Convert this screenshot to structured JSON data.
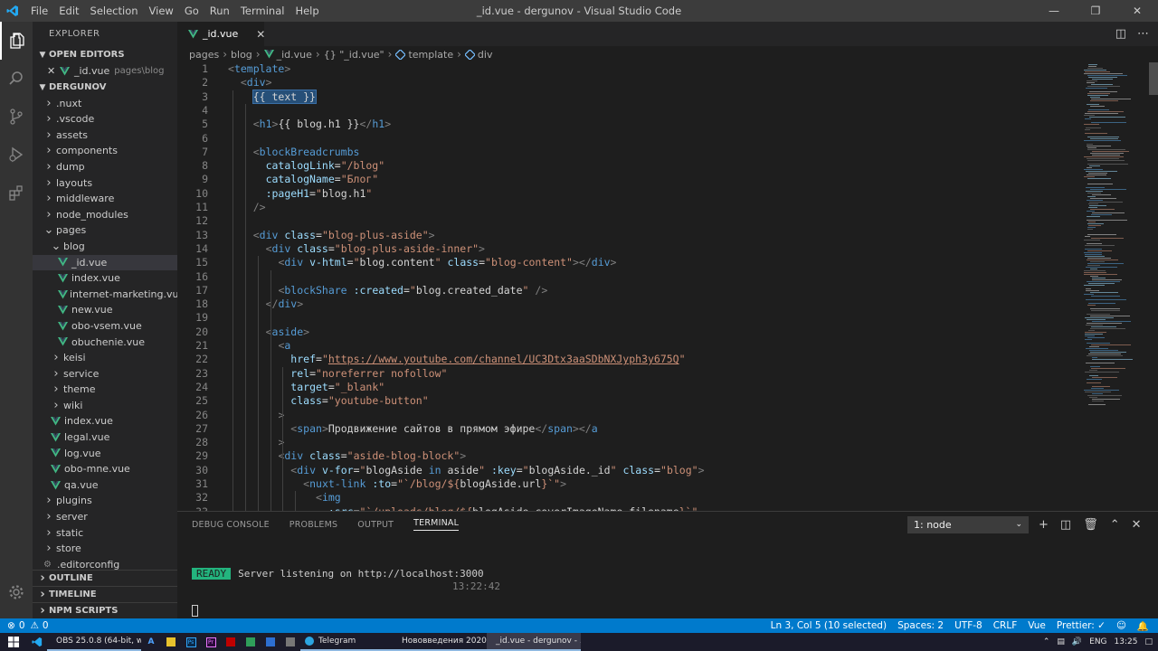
{
  "window": {
    "title": "_id.vue - dergunov - Visual Studio Code",
    "menu": [
      "File",
      "Edit",
      "Selection",
      "View",
      "Go",
      "Run",
      "Terminal",
      "Help"
    ]
  },
  "sidebar": {
    "title": "EXPLORER",
    "open_editors_label": "OPEN EDITORS",
    "open_editor": {
      "name": "_id.vue",
      "path": "pages\\blog"
    },
    "project_label": "DERGUNOV",
    "tree": [
      {
        "label": ".nuxt",
        "kind": "folder",
        "depth": 1
      },
      {
        "label": ".vscode",
        "kind": "folder",
        "depth": 1
      },
      {
        "label": "assets",
        "kind": "folder",
        "depth": 1
      },
      {
        "label": "components",
        "kind": "folder",
        "depth": 1
      },
      {
        "label": "dump",
        "kind": "folder",
        "depth": 1
      },
      {
        "label": "layouts",
        "kind": "folder",
        "depth": 1
      },
      {
        "label": "middleware",
        "kind": "folder",
        "depth": 1
      },
      {
        "label": "node_modules",
        "kind": "folder",
        "depth": 1
      },
      {
        "label": "pages",
        "kind": "folder-open",
        "depth": 1
      },
      {
        "label": "blog",
        "kind": "folder-open",
        "depth": 2
      },
      {
        "label": "_id.vue",
        "kind": "vue",
        "depth": 3,
        "selected": true
      },
      {
        "label": "index.vue",
        "kind": "vue",
        "depth": 3
      },
      {
        "label": "internet-marketing.vue",
        "kind": "vue",
        "depth": 3
      },
      {
        "label": "new.vue",
        "kind": "vue",
        "depth": 3
      },
      {
        "label": "obo-vsem.vue",
        "kind": "vue",
        "depth": 3
      },
      {
        "label": "obuchenie.vue",
        "kind": "vue",
        "depth": 3
      },
      {
        "label": "keisi",
        "kind": "folder",
        "depth": 2
      },
      {
        "label": "service",
        "kind": "folder",
        "depth": 2
      },
      {
        "label": "theme",
        "kind": "folder",
        "depth": 2
      },
      {
        "label": "wiki",
        "kind": "folder",
        "depth": 2
      },
      {
        "label": "index.vue",
        "kind": "vue",
        "depth": 2
      },
      {
        "label": "legal.vue",
        "kind": "vue",
        "depth": 2
      },
      {
        "label": "log.vue",
        "kind": "vue",
        "depth": 2
      },
      {
        "label": "obo-mne.vue",
        "kind": "vue",
        "depth": 2
      },
      {
        "label": "qa.vue",
        "kind": "vue",
        "depth": 2
      },
      {
        "label": "plugins",
        "kind": "folder",
        "depth": 1
      },
      {
        "label": "server",
        "kind": "folder",
        "depth": 1
      },
      {
        "label": "static",
        "kind": "folder",
        "depth": 1
      },
      {
        "label": "store",
        "kind": "folder",
        "depth": 1
      },
      {
        "label": ".editorconfig",
        "kind": "config",
        "depth": 1
      }
    ],
    "bottom_sections": [
      "OUTLINE",
      "TIMELINE",
      "NPM SCRIPTS"
    ]
  },
  "editor": {
    "tab_label": "_id.vue",
    "breadcrumb": [
      "pages",
      "blog",
      "_id.vue",
      "{} \"_id.vue\"",
      "template",
      "div"
    ],
    "lines": [
      {
        "n": 1,
        "indent": 0,
        "parts": [
          [
            "br",
            "<"
          ],
          [
            "tg",
            "template"
          ],
          [
            "br",
            ">"
          ]
        ]
      },
      {
        "n": 2,
        "indent": 1,
        "parts": [
          [
            "br",
            "<"
          ],
          [
            "tg",
            "div"
          ],
          [
            "br",
            ">"
          ]
        ]
      },
      {
        "n": 3,
        "indent": 2,
        "parts": [
          [
            "sel",
            "{{ text }}"
          ]
        ]
      },
      {
        "n": 4,
        "indent": 0,
        "parts": []
      },
      {
        "n": 5,
        "indent": 2,
        "parts": [
          [
            "br",
            "<"
          ],
          [
            "tg",
            "h1"
          ],
          [
            "br",
            ">"
          ],
          [
            "tx",
            "{{ blog.h1 }}"
          ],
          [
            "br",
            "</"
          ],
          [
            "tg",
            "h1"
          ],
          [
            "br",
            ">"
          ]
        ]
      },
      {
        "n": 6,
        "indent": 0,
        "parts": []
      },
      {
        "n": 7,
        "indent": 2,
        "parts": [
          [
            "br",
            "<"
          ],
          [
            "tg",
            "blockBreadcrumbs"
          ]
        ]
      },
      {
        "n": 8,
        "indent": 3,
        "parts": [
          [
            "at",
            "catalogLink"
          ],
          [
            "tx",
            "="
          ],
          [
            "st",
            "\"/blog\""
          ]
        ]
      },
      {
        "n": 9,
        "indent": 3,
        "parts": [
          [
            "at",
            "catalogName"
          ],
          [
            "tx",
            "="
          ],
          [
            "st",
            "\"Блог\""
          ]
        ]
      },
      {
        "n": 10,
        "indent": 3,
        "parts": [
          [
            "at",
            ":pageH1"
          ],
          [
            "tx",
            "="
          ],
          [
            "st",
            "\""
          ],
          [
            "tx",
            "blog.h1"
          ],
          [
            "st",
            "\""
          ]
        ]
      },
      {
        "n": 11,
        "indent": 2,
        "parts": [
          [
            "br",
            "/>"
          ]
        ]
      },
      {
        "n": 12,
        "indent": 0,
        "parts": []
      },
      {
        "n": 13,
        "indent": 2,
        "parts": [
          [
            "br",
            "<"
          ],
          [
            "tg",
            "div"
          ],
          [
            "tx",
            " "
          ],
          [
            "at",
            "class"
          ],
          [
            "tx",
            "="
          ],
          [
            "st",
            "\"blog-plus-aside\""
          ],
          [
            "br",
            ">"
          ]
        ]
      },
      {
        "n": 14,
        "indent": 3,
        "parts": [
          [
            "br",
            "<"
          ],
          [
            "tg",
            "div"
          ],
          [
            "tx",
            " "
          ],
          [
            "at",
            "class"
          ],
          [
            "tx",
            "="
          ],
          [
            "st",
            "\"blog-plus-aside-inner\""
          ],
          [
            "br",
            ">"
          ]
        ]
      },
      {
        "n": 15,
        "indent": 4,
        "parts": [
          [
            "br",
            "<"
          ],
          [
            "tg",
            "div"
          ],
          [
            "tx",
            " "
          ],
          [
            "at",
            "v-html"
          ],
          [
            "tx",
            "="
          ],
          [
            "st",
            "\""
          ],
          [
            "tx",
            "blog.content"
          ],
          [
            "st",
            "\""
          ],
          [
            "tx",
            " "
          ],
          [
            "at",
            "class"
          ],
          [
            "tx",
            "="
          ],
          [
            "st",
            "\"blog-content\""
          ],
          [
            "br",
            "></"
          ],
          [
            "tg",
            "div"
          ],
          [
            "br",
            ">"
          ]
        ]
      },
      {
        "n": 16,
        "indent": 0,
        "parts": []
      },
      {
        "n": 17,
        "indent": 4,
        "parts": [
          [
            "br",
            "<"
          ],
          [
            "tg",
            "blockShare"
          ],
          [
            "tx",
            " "
          ],
          [
            "at",
            ":created"
          ],
          [
            "tx",
            "="
          ],
          [
            "st",
            "\""
          ],
          [
            "tx",
            "blog.created_date"
          ],
          [
            "st",
            "\""
          ],
          [
            "tx",
            " "
          ],
          [
            "br",
            "/>"
          ]
        ]
      },
      {
        "n": 18,
        "indent": 3,
        "parts": [
          [
            "br",
            "</"
          ],
          [
            "tg",
            "div"
          ],
          [
            "br",
            ">"
          ]
        ]
      },
      {
        "n": 19,
        "indent": 0,
        "parts": []
      },
      {
        "n": 20,
        "indent": 3,
        "parts": [
          [
            "br",
            "<"
          ],
          [
            "tg",
            "aside"
          ],
          [
            "br",
            ">"
          ]
        ]
      },
      {
        "n": 21,
        "indent": 4,
        "parts": [
          [
            "br",
            "<"
          ],
          [
            "tg",
            "a"
          ]
        ]
      },
      {
        "n": 22,
        "indent": 5,
        "parts": [
          [
            "at",
            "href"
          ],
          [
            "tx",
            "="
          ],
          [
            "st",
            "\""
          ],
          [
            "url",
            "https://www.youtube.com/channel/UC3Dtx3aaSDbNXJyph3y675Q"
          ],
          [
            "st",
            "\""
          ]
        ]
      },
      {
        "n": 23,
        "indent": 5,
        "parts": [
          [
            "at",
            "rel"
          ],
          [
            "tx",
            "="
          ],
          [
            "st",
            "\"noreferrer nofollow\""
          ]
        ]
      },
      {
        "n": 24,
        "indent": 5,
        "parts": [
          [
            "at",
            "target"
          ],
          [
            "tx",
            "="
          ],
          [
            "st",
            "\"_blank\""
          ]
        ]
      },
      {
        "n": 25,
        "indent": 5,
        "parts": [
          [
            "at",
            "class"
          ],
          [
            "tx",
            "="
          ],
          [
            "st",
            "\"youtube-button\""
          ]
        ]
      },
      {
        "n": 26,
        "indent": 4,
        "parts": [
          [
            "br",
            ">"
          ]
        ]
      },
      {
        "n": 27,
        "indent": 5,
        "parts": [
          [
            "br",
            "<"
          ],
          [
            "tg",
            "span"
          ],
          [
            "br",
            ">"
          ],
          [
            "tx",
            "Продвижение сайтов в прямом эфире"
          ],
          [
            "br",
            "</"
          ],
          [
            "tg",
            "span"
          ],
          [
            "br",
            "></"
          ],
          [
            "tg",
            "a"
          ]
        ]
      },
      {
        "n": 28,
        "indent": 4,
        "parts": [
          [
            "br",
            ">"
          ]
        ]
      },
      {
        "n": 29,
        "indent": 4,
        "parts": [
          [
            "br",
            "<"
          ],
          [
            "tg",
            "div"
          ],
          [
            "tx",
            " "
          ],
          [
            "at",
            "class"
          ],
          [
            "tx",
            "="
          ],
          [
            "st",
            "\"aside-blog-block\""
          ],
          [
            "br",
            ">"
          ]
        ]
      },
      {
        "n": 30,
        "indent": 5,
        "parts": [
          [
            "br",
            "<"
          ],
          [
            "tg",
            "div"
          ],
          [
            "tx",
            " "
          ],
          [
            "at",
            "v-for"
          ],
          [
            "tx",
            "="
          ],
          [
            "st",
            "\""
          ],
          [
            "tx",
            "blogAside "
          ],
          [
            "tg",
            "in"
          ],
          [
            "tx",
            " aside"
          ],
          [
            "st",
            "\""
          ],
          [
            "tx",
            " "
          ],
          [
            "at",
            ":key"
          ],
          [
            "tx",
            "="
          ],
          [
            "st",
            "\""
          ],
          [
            "tx",
            "blogAside._id"
          ],
          [
            "st",
            "\""
          ],
          [
            "tx",
            " "
          ],
          [
            "at",
            "class"
          ],
          [
            "tx",
            "="
          ],
          [
            "st",
            "\"blog\""
          ],
          [
            "br",
            ">"
          ]
        ]
      },
      {
        "n": 31,
        "indent": 6,
        "parts": [
          [
            "br",
            "<"
          ],
          [
            "tg",
            "nuxt-link"
          ],
          [
            "tx",
            " "
          ],
          [
            "at",
            ":to"
          ],
          [
            "tx",
            "="
          ],
          [
            "st",
            "\"`/blog/${"
          ],
          [
            "tx",
            "blogAside.url"
          ],
          [
            "st",
            "}`\""
          ],
          [
            "br",
            ">"
          ]
        ]
      },
      {
        "n": 32,
        "indent": 7,
        "parts": [
          [
            "br",
            "<"
          ],
          [
            "tg",
            "img"
          ]
        ]
      },
      {
        "n": 33,
        "indent": 8,
        "parts": [
          [
            "at",
            ":src"
          ],
          [
            "tx",
            "="
          ],
          [
            "st",
            "\"`/uploads/blog/${"
          ],
          [
            "tx",
            "blogAside.coverImageName.filename"
          ],
          [
            "st",
            "}`\""
          ]
        ]
      }
    ]
  },
  "panel": {
    "tabs": [
      "DEBUG CONSOLE",
      "PROBLEMS",
      "OUTPUT",
      "TERMINAL"
    ],
    "active_tab": "TERMINAL",
    "terminal_select": "1: node",
    "ready_badge": "READY",
    "message": "Server listening on http://localhost:3000",
    "time": "13:22:42"
  },
  "statusbar": {
    "errors": "0",
    "warnings": "0",
    "position": "Ln 3, Col 5 (10 selected)",
    "spaces": "Spaces: 2",
    "encoding": "UTF-8",
    "eol": "CRLF",
    "language": "Vue",
    "prettier": "Prettier: ✓"
  },
  "taskbar": {
    "tasks": [
      {
        "label": "OBS 25.0.8 (64-bit, wi...",
        "active": false
      },
      {
        "label": "Telegram",
        "active": false
      },
      {
        "label": "Нововведения 2020 ...",
        "active": false
      },
      {
        "label": "_id.vue - dergunov - ...",
        "active": true
      }
    ],
    "lang": "ENG",
    "clock": "13:25"
  },
  "colors": {
    "accent": "#007acc",
    "vue_green": "#41b883",
    "ready_green": "#23b47e"
  }
}
